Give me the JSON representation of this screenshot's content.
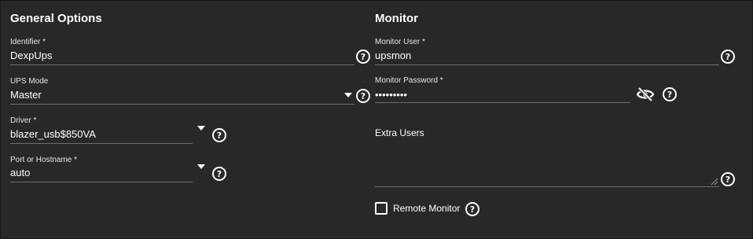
{
  "general": {
    "title": "General Options",
    "identifier": {
      "label": "Identifier *",
      "value": "DexpUps"
    },
    "ups_mode": {
      "label": "UPS Mode",
      "value": "Master"
    },
    "driver": {
      "label": "Driver *",
      "value": "blazer_usb$850VA"
    },
    "port": {
      "label": "Port or Hostname *",
      "value": "auto"
    }
  },
  "monitor": {
    "title": "Monitor",
    "user": {
      "label": "Monitor User *",
      "value": "upsmon"
    },
    "password": {
      "label": "Monitor Password *",
      "value": "•••••••••"
    },
    "extra_users": {
      "label": "Extra Users",
      "value": ""
    },
    "remote_monitor": {
      "label": "Remote Monitor",
      "checked": false
    }
  },
  "icons": {
    "help": "help-circle-icon",
    "dropdown": "chevron-down-icon",
    "visibility": "eye-off-icon",
    "help_glyph": "?"
  },
  "colors": {
    "background": "#282828",
    "text": "#ffffff",
    "underline": "#6e6e6e"
  }
}
